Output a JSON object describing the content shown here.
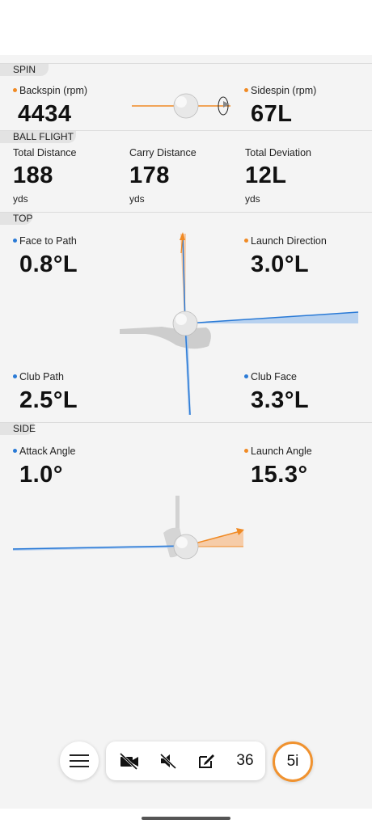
{
  "spin": {
    "tab": "SPIN",
    "backspin_label": "Backspin (rpm)",
    "backspin_value": "4434",
    "sidespin_label": "Sidespin (rpm)",
    "sidespin_value": "67L"
  },
  "ball_flight": {
    "tab": "BALL FLIGHT",
    "total_distance_label": "Total Distance",
    "total_distance_value": "188",
    "total_distance_unit": "yds",
    "carry_distance_label": "Carry Distance",
    "carry_distance_value": "178",
    "carry_distance_unit": "yds",
    "total_deviation_label": "Total Deviation",
    "total_deviation_value": "12L",
    "total_deviation_unit": "yds"
  },
  "top": {
    "tab": "TOP",
    "face_to_path_label": "Face to Path",
    "face_to_path_value": "0.8°L",
    "launch_direction_label": "Launch Direction",
    "launch_direction_value": "3.0°L",
    "club_path_label": "Club Path",
    "club_path_value": "2.5°L",
    "club_face_label": "Club Face",
    "club_face_value": "3.3°L"
  },
  "side": {
    "tab": "SIDE",
    "attack_angle_label": "Attack Angle",
    "attack_angle_value": "1.0°",
    "launch_angle_label": "Launch Angle",
    "launch_angle_value": "15.3°"
  },
  "toolbar": {
    "menu_icon": "hamburger-menu-icon",
    "video_icon": "video-off-icon",
    "sound_icon": "sound-off-icon",
    "edit_icon": "edit-note-icon",
    "shot_count": "36",
    "club": "5i"
  },
  "colors": {
    "accent_orange": "#f08a24",
    "accent_blue": "#2a7ad6"
  }
}
